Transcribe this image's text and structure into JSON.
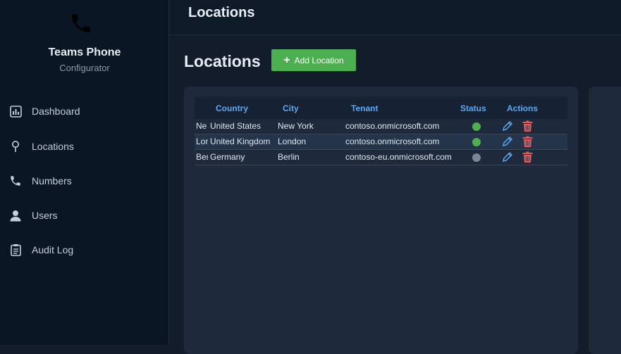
{
  "app": {
    "name": "Teams Phone",
    "subtitle": "Configurator"
  },
  "sidebar": {
    "items": [
      {
        "label": "Dashboard",
        "icon": "dashboard-icon"
      },
      {
        "label": "Locations",
        "icon": "location-pin-icon"
      },
      {
        "label": "Numbers",
        "icon": "phone-icon"
      },
      {
        "label": "Users",
        "icon": "user-icon"
      },
      {
        "label": "Audit Log",
        "icon": "clipboard-icon"
      }
    ]
  },
  "header": {
    "title": "Locations"
  },
  "main": {
    "title": "Locations",
    "add_button_label": "Add Location",
    "table": {
      "columns": [
        "Country",
        "City",
        "Tenant",
        "Status",
        "Actions"
      ],
      "rows": [
        {
          "name": "Ne",
          "country": "United States",
          "city": "New York",
          "tenant": "contoso.onmicrosoft.com",
          "status": "active"
        },
        {
          "name": "Lor",
          "country": "United Kingdom",
          "city": "London",
          "tenant": "contoso.onmicrosoft.com",
          "status": "active"
        },
        {
          "name": "Ber",
          "country": "Germany",
          "city": "Berlin",
          "tenant": "contoso-eu.onmicrosoft.com",
          "status": "inactive"
        }
      ]
    }
  },
  "colors": {
    "accent": "#5aa9f0",
    "add_button": "#4caf50",
    "status_active": "#4caf50",
    "status_inactive": "#7b8794",
    "delete": "#e05a5a"
  }
}
